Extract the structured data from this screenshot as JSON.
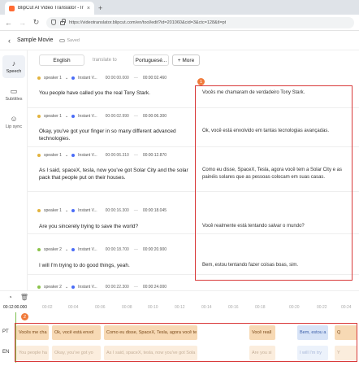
{
  "browser": {
    "tab_title": "BlipCut AI Video Translator - Ir",
    "url": "https://videotranslator.blipcut.com/en/tool/edit?id=201060&cid=3&ctc=128&tl=pt"
  },
  "header": {
    "title": "Sample Movie",
    "saved": "Saved"
  },
  "sidebar": {
    "items": [
      {
        "label": "Speech",
        "icon": "waveform-icon"
      },
      {
        "label": "Subtitles",
        "icon": "subtitles-icon"
      },
      {
        "label": "Lip sync",
        "icon": "lipsync-icon"
      }
    ]
  },
  "langbar": {
    "source": "English",
    "middle": "translate to",
    "target": "Portuguesé...",
    "more": "+ More"
  },
  "segments": [
    {
      "speaker": "speaker 1",
      "voice": "Instant V...",
      "start": "00:00:00.000",
      "end": "00:00:02.460",
      "source": "You people have called you the real Tony Stark.",
      "target": "Vocês me chamaram de verdadeiro Tony Stark."
    },
    {
      "speaker": "speaker 1",
      "voice": "Instant V...",
      "start": "00:00:02.990",
      "end": "00:00:06.300",
      "source": "Okay, you've got your finger in so many different advanced technologies.",
      "target": "Ok, você está envolvido em tantas tecnologias avançadas."
    },
    {
      "speaker": "speaker 1",
      "voice": "Instant V...",
      "start": "00:00:06.310",
      "end": "00:00:12.870",
      "source": "As I said, spaceX, tesla, now you've got Solar City and the solar pack that people put on their houses.",
      "target": "Como eu disse, SpaceX, Tesla, agora você tem a Solar City e as painéis solares que as pessoas colocam em suas casas."
    },
    {
      "speaker": "speaker 1",
      "voice": "Instant V...",
      "start": "00:00:16.300",
      "end": "00:00:18.045",
      "source": "Are you sincerely trying to save the world?",
      "target": "Você realmente está tentando salvar o mundo?"
    },
    {
      "speaker": "speaker 2",
      "voice": "Instant V...",
      "start": "00:00:18.700",
      "end": "00:00:20.900",
      "source": "I will I'm trying to do good things, yeah.",
      "target": "Bem, estou tentando fazer coisas boas, sim."
    },
    {
      "speaker": "speaker 2",
      "voice": "Instant V...",
      "start": "00:00:22.300",
      "end": "00:00:24.000",
      "source": "",
      "target": ""
    }
  ],
  "annotations": {
    "box1": "1",
    "box2": "2"
  },
  "timeline": {
    "current": "00:12:00.000",
    "ticks": [
      "00:02",
      "00:04",
      "00:06",
      "00:08",
      "00:10",
      "00:12",
      "00:14",
      "00:16",
      "00:18",
      "00:20",
      "00:22",
      "00:24"
    ],
    "tracks": [
      {
        "label": "PT",
        "clips": [
          "Vocês me cha",
          "Ok, você está envol",
          "Como eu disse, SpaceX, Tesla, agora você te",
          "Você reall",
          "Bem, estou a",
          "Q"
        ]
      },
      {
        "label": "EN",
        "clips": [
          "You people ha",
          "Okay, you've got yo",
          "As I said, spaceX, tesla, now you've got Sola",
          "Are you si",
          "I will I'm try",
          "Y"
        ]
      }
    ]
  },
  "colors": {
    "annotation": "#d93a3a",
    "badge": "#f07a3a",
    "clip_pt": "#f7d9b4",
    "clip_blue": "#d7e3f7"
  }
}
